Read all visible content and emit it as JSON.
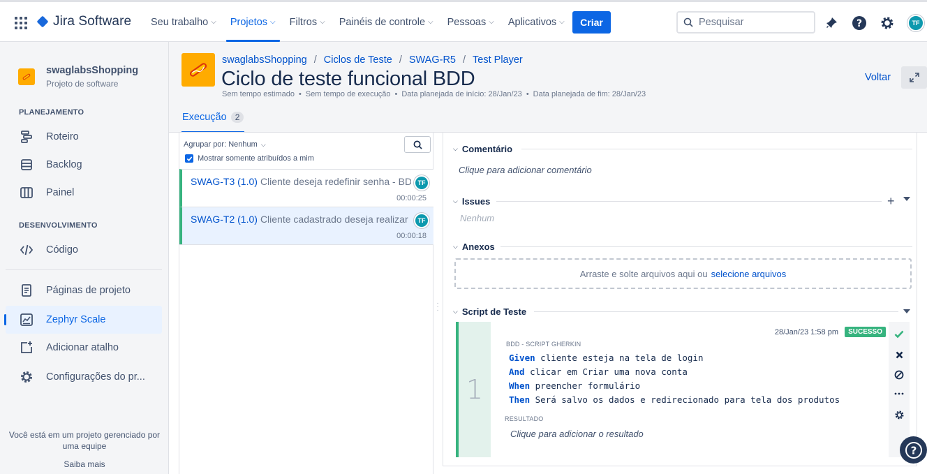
{
  "topnav": {
    "product": "Jira Software",
    "items": [
      {
        "label": "Seu trabalho",
        "active": false
      },
      {
        "label": "Projetos",
        "active": true
      },
      {
        "label": "Filtros",
        "active": false
      },
      {
        "label": "Painéis de controle",
        "active": false
      },
      {
        "label": "Pessoas",
        "active": false
      },
      {
        "label": "Aplicativos",
        "active": false
      }
    ],
    "create_label": "Criar",
    "search_placeholder": "Pesquisar",
    "user_initials": "TF",
    "icons": [
      "apps-grid-icon",
      "notifications-icon",
      "help-icon",
      "settings-icon"
    ]
  },
  "sidebar": {
    "project_name": "swaglabsShopping",
    "project_type": "Projeto de software",
    "sections": [
      {
        "heading": "PLANEJAMENTO",
        "items": [
          {
            "label": "Roteiro",
            "icon": "roadmap-icon"
          },
          {
            "label": "Backlog",
            "icon": "backlog-icon"
          },
          {
            "label": "Painel",
            "icon": "board-icon"
          }
        ]
      },
      {
        "heading": "DESENVOLVIMENTO",
        "items": [
          {
            "label": "Código",
            "icon": "code-icon"
          }
        ]
      }
    ],
    "other_items": [
      {
        "label": "Páginas de projeto",
        "icon": "pages-icon",
        "selected": false
      },
      {
        "label": "Zephyr Scale",
        "icon": "zephyr-icon",
        "selected": true
      },
      {
        "label": "Adicionar atalho",
        "icon": "add-shortcut-icon",
        "selected": false
      },
      {
        "label": "Configurações do pr...",
        "icon": "settings-icon",
        "selected": false
      }
    ],
    "footer_text": "Você está em um projeto gerenciado por uma equipe",
    "footer_link": "Saiba mais"
  },
  "header": {
    "breadcrumb": [
      "swaglabsShopping",
      "Ciclos de Teste",
      "SWAG-R5",
      "Test Player"
    ],
    "title": "Ciclo de teste funcional BDD",
    "meta": [
      "Sem tempo estimado",
      "Sem tempo de execução",
      "Data planejada de início: 28/Jan/23",
      "Data planejada de fim: 28/Jan/23"
    ],
    "back_label": "Voltar",
    "tab_label": "Execução",
    "tab_count": "2"
  },
  "list": {
    "group_by": "Agrupar por: Nenhum",
    "only_mine_label": "Mostrar somente atribuídos a mim",
    "only_mine_checked": true,
    "rows": [
      {
        "key": "SWAG-T3 (1.0)",
        "desc": "Cliente deseja redefinir senha - BDD",
        "time": "00:00:25",
        "assignee": "TF",
        "selected": false
      },
      {
        "key": "SWAG-T2 (1.0)",
        "desc": "Cliente cadastrado deseja realizar login",
        "time": "00:00:18",
        "assignee": "TF",
        "selected": true
      }
    ]
  },
  "detail": {
    "comment_heading": "Comentário",
    "comment_placeholder": "Clique para adicionar comentário",
    "issues_heading": "Issues",
    "issues_empty": "Nenhum",
    "attachments_heading": "Anexos",
    "drop_text": "Arraste e solte arquivos aqui ou",
    "drop_link": "selecione arquivos",
    "script_heading": "Script de Teste",
    "script": {
      "step_number": "1",
      "date": "28/Jan/23 1:58 pm",
      "status": "SUCESSO",
      "status_color": "#36b37e",
      "script_label": "BDD - SCRIPT GHERKIN",
      "lines": [
        {
          "kw": "Given",
          "text": "cliente esteja na tela de login"
        },
        {
          "kw": "And",
          "text": "clicar em Criar uma nova conta"
        },
        {
          "kw": "When",
          "text": "preencher formulário"
        },
        {
          "kw": "Then",
          "text": "Será salvo os dados e redirecionado para tela dos produtos"
        }
      ],
      "result_label": "RESULTADO",
      "result_placeholder": "Clique para adicionar o resultado"
    }
  },
  "colors": {
    "accent": "#0c66e4",
    "link": "#0052cc",
    "success": "#36b37e",
    "project_icon": "#ffab00"
  }
}
